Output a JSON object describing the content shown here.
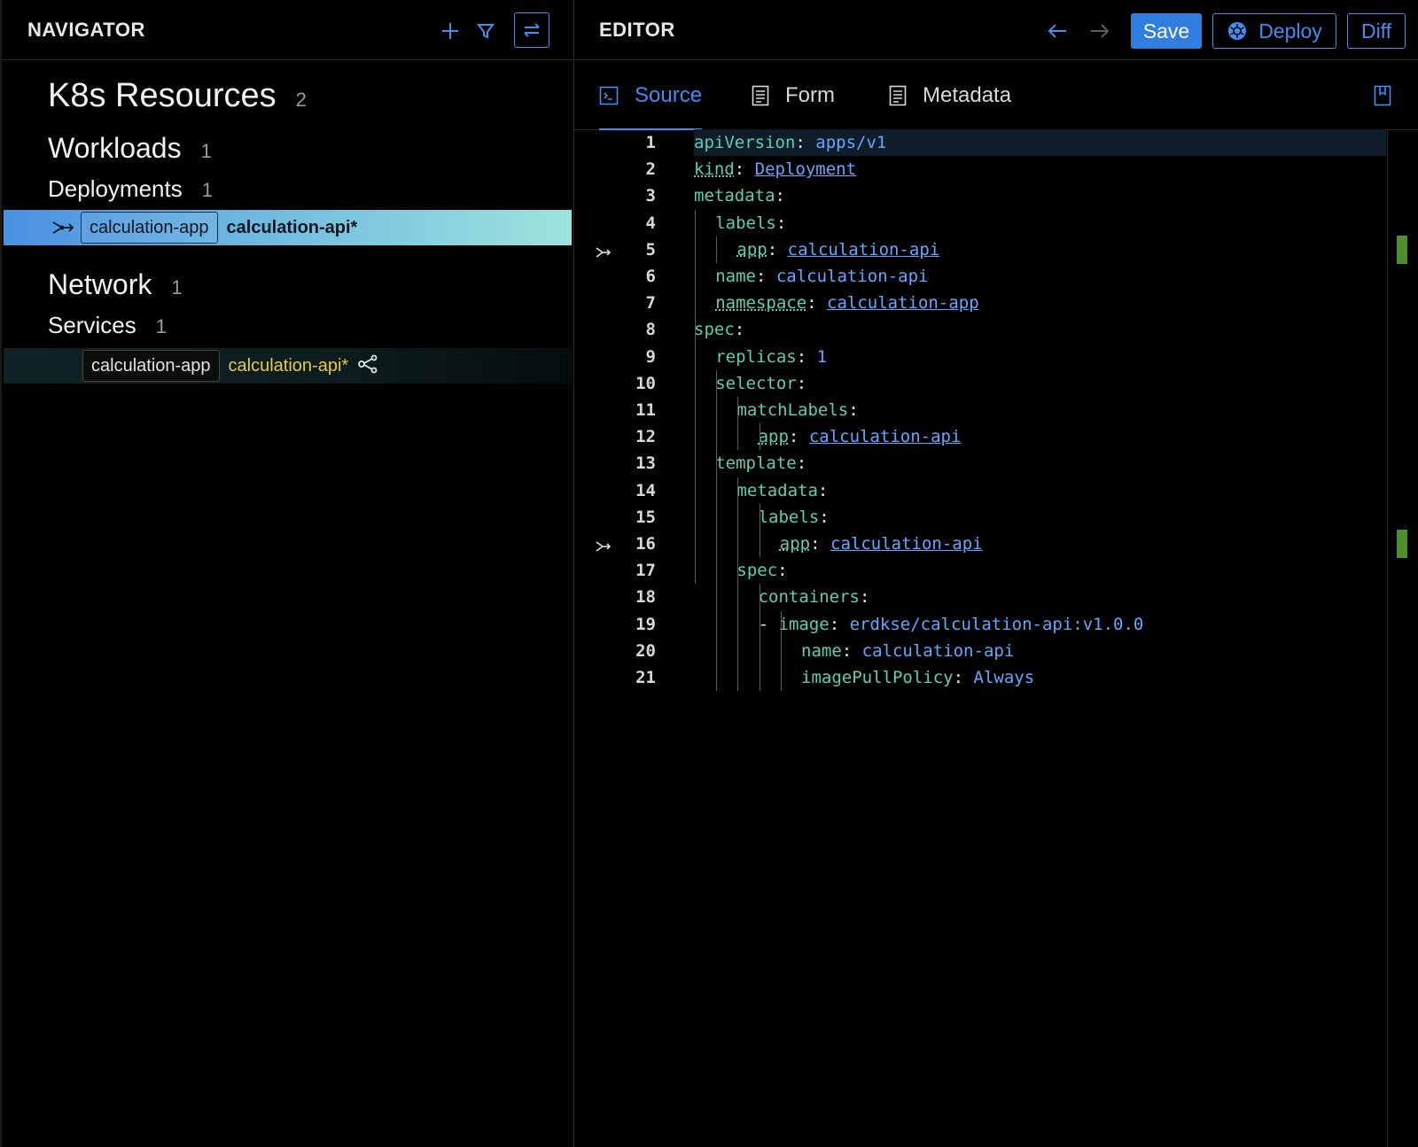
{
  "navigator": {
    "title": "NAVIGATOR",
    "k8s": {
      "label": "K8s Resources",
      "count": "2"
    },
    "workloads": {
      "label": "Workloads",
      "count": "1"
    },
    "deployments": {
      "label": "Deployments",
      "count": "1"
    },
    "deployment_item": {
      "namespace": "calculation-app",
      "name": "calculation-api*"
    },
    "network": {
      "label": "Network",
      "count": "1"
    },
    "services": {
      "label": "Services",
      "count": "1"
    },
    "service_item": {
      "namespace": "calculation-app",
      "name": "calculation-api*"
    },
    "icons": [
      "plus-icon",
      "filter-icon",
      "collapse-icon"
    ]
  },
  "editor": {
    "title": "EDITOR",
    "save_label": "Save",
    "deploy_label": "Deploy",
    "diff_label": "Diff",
    "tabs": {
      "source": "Source",
      "form": "Form",
      "metadata": "Metadata"
    }
  },
  "code": {
    "lines": [
      {
        "n": "1",
        "k": "apiVersion",
        "v": "apps/v1"
      },
      {
        "n": "2",
        "k": "kind",
        "v": "Deployment"
      },
      {
        "n": "3",
        "k": "metadata",
        "v": ""
      },
      {
        "n": "4",
        "k": "labels",
        "v": ""
      },
      {
        "n": "5",
        "k": "app",
        "v": "calculation-api"
      },
      {
        "n": "6",
        "k": "name",
        "v": "calculation-api"
      },
      {
        "n": "7",
        "k": "namespace",
        "v": "calculation-app"
      },
      {
        "n": "8",
        "k": "spec",
        "v": ""
      },
      {
        "n": "9",
        "k": "replicas",
        "v": "1"
      },
      {
        "n": "10",
        "k": "selector",
        "v": ""
      },
      {
        "n": "11",
        "k": "matchLabels",
        "v": ""
      },
      {
        "n": "12",
        "k": "app",
        "v": "calculation-api"
      },
      {
        "n": "13",
        "k": "template",
        "v": ""
      },
      {
        "n": "14",
        "k": "metadata",
        "v": ""
      },
      {
        "n": "15",
        "k": "labels",
        "v": ""
      },
      {
        "n": "16",
        "k": "app",
        "v": "calculation-api"
      },
      {
        "n": "17",
        "k": "spec",
        "v": ""
      },
      {
        "n": "18",
        "k": "containers",
        "v": ""
      },
      {
        "n": "19",
        "k": "image",
        "v": "erdkse/calculation-api:v1.0.0",
        "dash": "-"
      },
      {
        "n": "20",
        "k": "name",
        "v": "calculation-api"
      },
      {
        "n": "21",
        "k": "imagePullPolicy",
        "v": "Always"
      }
    ]
  },
  "colors": {
    "accent": "#3f8ef2",
    "key": "#5bd0b0",
    "value": "#62a8ff",
    "warning": "#e8c94a",
    "change_marker": "#4d8f2f"
  }
}
